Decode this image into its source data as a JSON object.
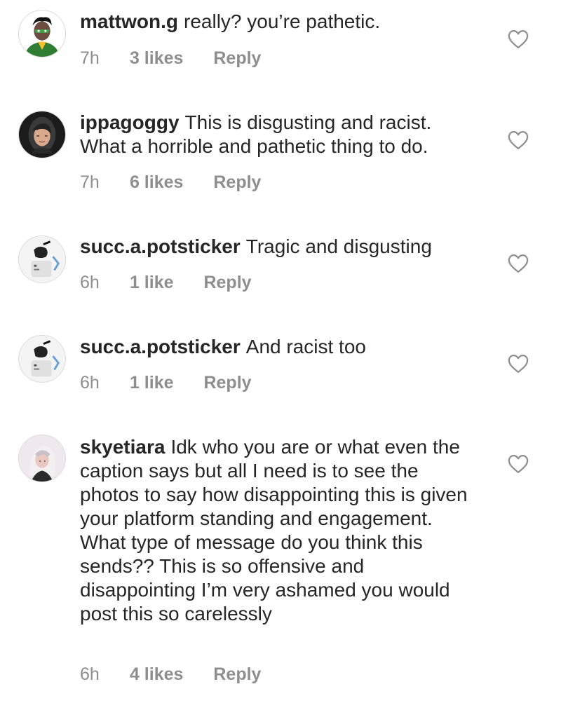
{
  "comments": [
    {
      "username": "mattwon.g",
      "text": "really? you’re pathetic.",
      "time": "7h",
      "likes": "3 likes",
      "reply": "Reply",
      "avatar_icon": "superhero-avatar-icon",
      "avatar_color": "#2e8b3a"
    },
    {
      "username": "ippagoggy",
      "text": "This is disgusting and racist. What a horrible and pathetic thing to do.",
      "time": "7h",
      "likes": "6 likes",
      "reply": "Reply",
      "avatar_icon": "woman-portrait-avatar-icon",
      "avatar_color": "#2b2b2b"
    },
    {
      "username": "succ.a.potsticker",
      "text": "Tragic and disgusting",
      "time": "6h",
      "likes": "1 like",
      "reply": "Reply",
      "avatar_icon": "photo-avatar-icon",
      "avatar_color": "#e6e6e6"
    },
    {
      "username": "succ.a.potsticker",
      "text": "And racist too",
      "time": "6h",
      "likes": "1 like",
      "reply": "Reply",
      "avatar_icon": "photo-avatar-icon",
      "avatar_color": "#e6e6e6"
    },
    {
      "username": "skyetiara",
      "text": "Idk who you are or what even the caption says but all I need is to see the photos to say how disappointing this is given your platform standing and engagement. What type of message do you think this sends?? This is so offensive and disappointing I’m very ashamed you would post this so carelessly",
      "time": "6h",
      "likes": "4 likes",
      "reply": "Reply",
      "avatar_icon": "woman-portrait-avatar-icon",
      "avatar_color": "#d9c9d6"
    }
  ],
  "heart_icon": "heart-outline-icon",
  "colors": {
    "text": "#262626",
    "secondary": "#8e8e8e",
    "heart_stroke": "#8e8e8e"
  }
}
